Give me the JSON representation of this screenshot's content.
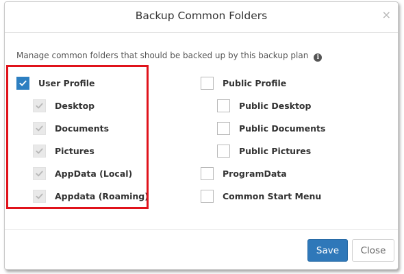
{
  "dialog": {
    "title": "Backup Common Folders",
    "close_glyph": "×",
    "description": "Manage common folders that should be backed up by this backup plan",
    "info_glyph": "i"
  },
  "left_column": [
    {
      "label": "User Profile",
      "state": "checked"
    },
    {
      "label": "Desktop",
      "state": "checked-disabled"
    },
    {
      "label": "Documents",
      "state": "checked-disabled"
    },
    {
      "label": "Pictures",
      "state": "checked-disabled"
    },
    {
      "label": "AppData (Local)",
      "state": "checked-disabled"
    },
    {
      "label": "Appdata (Roaming)",
      "state": "checked-disabled"
    }
  ],
  "right_column": [
    {
      "label": "Public Profile",
      "state": "unchecked"
    },
    {
      "label": "Public Desktop",
      "state": "unchecked"
    },
    {
      "label": "Public Documents",
      "state": "unchecked"
    },
    {
      "label": "Public Pictures",
      "state": "unchecked"
    },
    {
      "label": "ProgramData",
      "state": "unchecked"
    },
    {
      "label": "Common Start Menu",
      "state": "unchecked"
    }
  ],
  "footer": {
    "save_label": "Save",
    "close_label": "Close"
  },
  "colors": {
    "accent": "#2d7fc1",
    "highlight_border": "#e0131b",
    "disabled_check": "#b7b7b7"
  }
}
